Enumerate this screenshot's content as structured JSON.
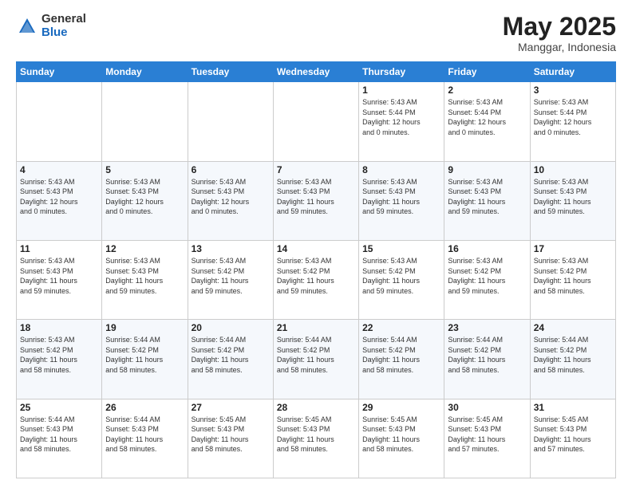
{
  "logo": {
    "general": "General",
    "blue": "Blue"
  },
  "title": {
    "month": "May 2025",
    "location": "Manggar, Indonesia"
  },
  "header_days": [
    "Sunday",
    "Monday",
    "Tuesday",
    "Wednesday",
    "Thursday",
    "Friday",
    "Saturday"
  ],
  "weeks": [
    [
      {
        "day": "",
        "info": ""
      },
      {
        "day": "",
        "info": ""
      },
      {
        "day": "",
        "info": ""
      },
      {
        "day": "",
        "info": ""
      },
      {
        "day": "1",
        "info": "Sunrise: 5:43 AM\nSunset: 5:44 PM\nDaylight: 12 hours\nand 0 minutes."
      },
      {
        "day": "2",
        "info": "Sunrise: 5:43 AM\nSunset: 5:44 PM\nDaylight: 12 hours\nand 0 minutes."
      },
      {
        "day": "3",
        "info": "Sunrise: 5:43 AM\nSunset: 5:44 PM\nDaylight: 12 hours\nand 0 minutes."
      }
    ],
    [
      {
        "day": "4",
        "info": "Sunrise: 5:43 AM\nSunset: 5:43 PM\nDaylight: 12 hours\nand 0 minutes."
      },
      {
        "day": "5",
        "info": "Sunrise: 5:43 AM\nSunset: 5:43 PM\nDaylight: 12 hours\nand 0 minutes."
      },
      {
        "day": "6",
        "info": "Sunrise: 5:43 AM\nSunset: 5:43 PM\nDaylight: 12 hours\nand 0 minutes."
      },
      {
        "day": "7",
        "info": "Sunrise: 5:43 AM\nSunset: 5:43 PM\nDaylight: 11 hours\nand 59 minutes."
      },
      {
        "day": "8",
        "info": "Sunrise: 5:43 AM\nSunset: 5:43 PM\nDaylight: 11 hours\nand 59 minutes."
      },
      {
        "day": "9",
        "info": "Sunrise: 5:43 AM\nSunset: 5:43 PM\nDaylight: 11 hours\nand 59 minutes."
      },
      {
        "day": "10",
        "info": "Sunrise: 5:43 AM\nSunset: 5:43 PM\nDaylight: 11 hours\nand 59 minutes."
      }
    ],
    [
      {
        "day": "11",
        "info": "Sunrise: 5:43 AM\nSunset: 5:43 PM\nDaylight: 11 hours\nand 59 minutes."
      },
      {
        "day": "12",
        "info": "Sunrise: 5:43 AM\nSunset: 5:43 PM\nDaylight: 11 hours\nand 59 minutes."
      },
      {
        "day": "13",
        "info": "Sunrise: 5:43 AM\nSunset: 5:42 PM\nDaylight: 11 hours\nand 59 minutes."
      },
      {
        "day": "14",
        "info": "Sunrise: 5:43 AM\nSunset: 5:42 PM\nDaylight: 11 hours\nand 59 minutes."
      },
      {
        "day": "15",
        "info": "Sunrise: 5:43 AM\nSunset: 5:42 PM\nDaylight: 11 hours\nand 59 minutes."
      },
      {
        "day": "16",
        "info": "Sunrise: 5:43 AM\nSunset: 5:42 PM\nDaylight: 11 hours\nand 59 minutes."
      },
      {
        "day": "17",
        "info": "Sunrise: 5:43 AM\nSunset: 5:42 PM\nDaylight: 11 hours\nand 58 minutes."
      }
    ],
    [
      {
        "day": "18",
        "info": "Sunrise: 5:43 AM\nSunset: 5:42 PM\nDaylight: 11 hours\nand 58 minutes."
      },
      {
        "day": "19",
        "info": "Sunrise: 5:44 AM\nSunset: 5:42 PM\nDaylight: 11 hours\nand 58 minutes."
      },
      {
        "day": "20",
        "info": "Sunrise: 5:44 AM\nSunset: 5:42 PM\nDaylight: 11 hours\nand 58 minutes."
      },
      {
        "day": "21",
        "info": "Sunrise: 5:44 AM\nSunset: 5:42 PM\nDaylight: 11 hours\nand 58 minutes."
      },
      {
        "day": "22",
        "info": "Sunrise: 5:44 AM\nSunset: 5:42 PM\nDaylight: 11 hours\nand 58 minutes."
      },
      {
        "day": "23",
        "info": "Sunrise: 5:44 AM\nSunset: 5:42 PM\nDaylight: 11 hours\nand 58 minutes."
      },
      {
        "day": "24",
        "info": "Sunrise: 5:44 AM\nSunset: 5:42 PM\nDaylight: 11 hours\nand 58 minutes."
      }
    ],
    [
      {
        "day": "25",
        "info": "Sunrise: 5:44 AM\nSunset: 5:43 PM\nDaylight: 11 hours\nand 58 minutes."
      },
      {
        "day": "26",
        "info": "Sunrise: 5:44 AM\nSunset: 5:43 PM\nDaylight: 11 hours\nand 58 minutes."
      },
      {
        "day": "27",
        "info": "Sunrise: 5:45 AM\nSunset: 5:43 PM\nDaylight: 11 hours\nand 58 minutes."
      },
      {
        "day": "28",
        "info": "Sunrise: 5:45 AM\nSunset: 5:43 PM\nDaylight: 11 hours\nand 58 minutes."
      },
      {
        "day": "29",
        "info": "Sunrise: 5:45 AM\nSunset: 5:43 PM\nDaylight: 11 hours\nand 58 minutes."
      },
      {
        "day": "30",
        "info": "Sunrise: 5:45 AM\nSunset: 5:43 PM\nDaylight: 11 hours\nand 57 minutes."
      },
      {
        "day": "31",
        "info": "Sunrise: 5:45 AM\nSunset: 5:43 PM\nDaylight: 11 hours\nand 57 minutes."
      }
    ]
  ]
}
